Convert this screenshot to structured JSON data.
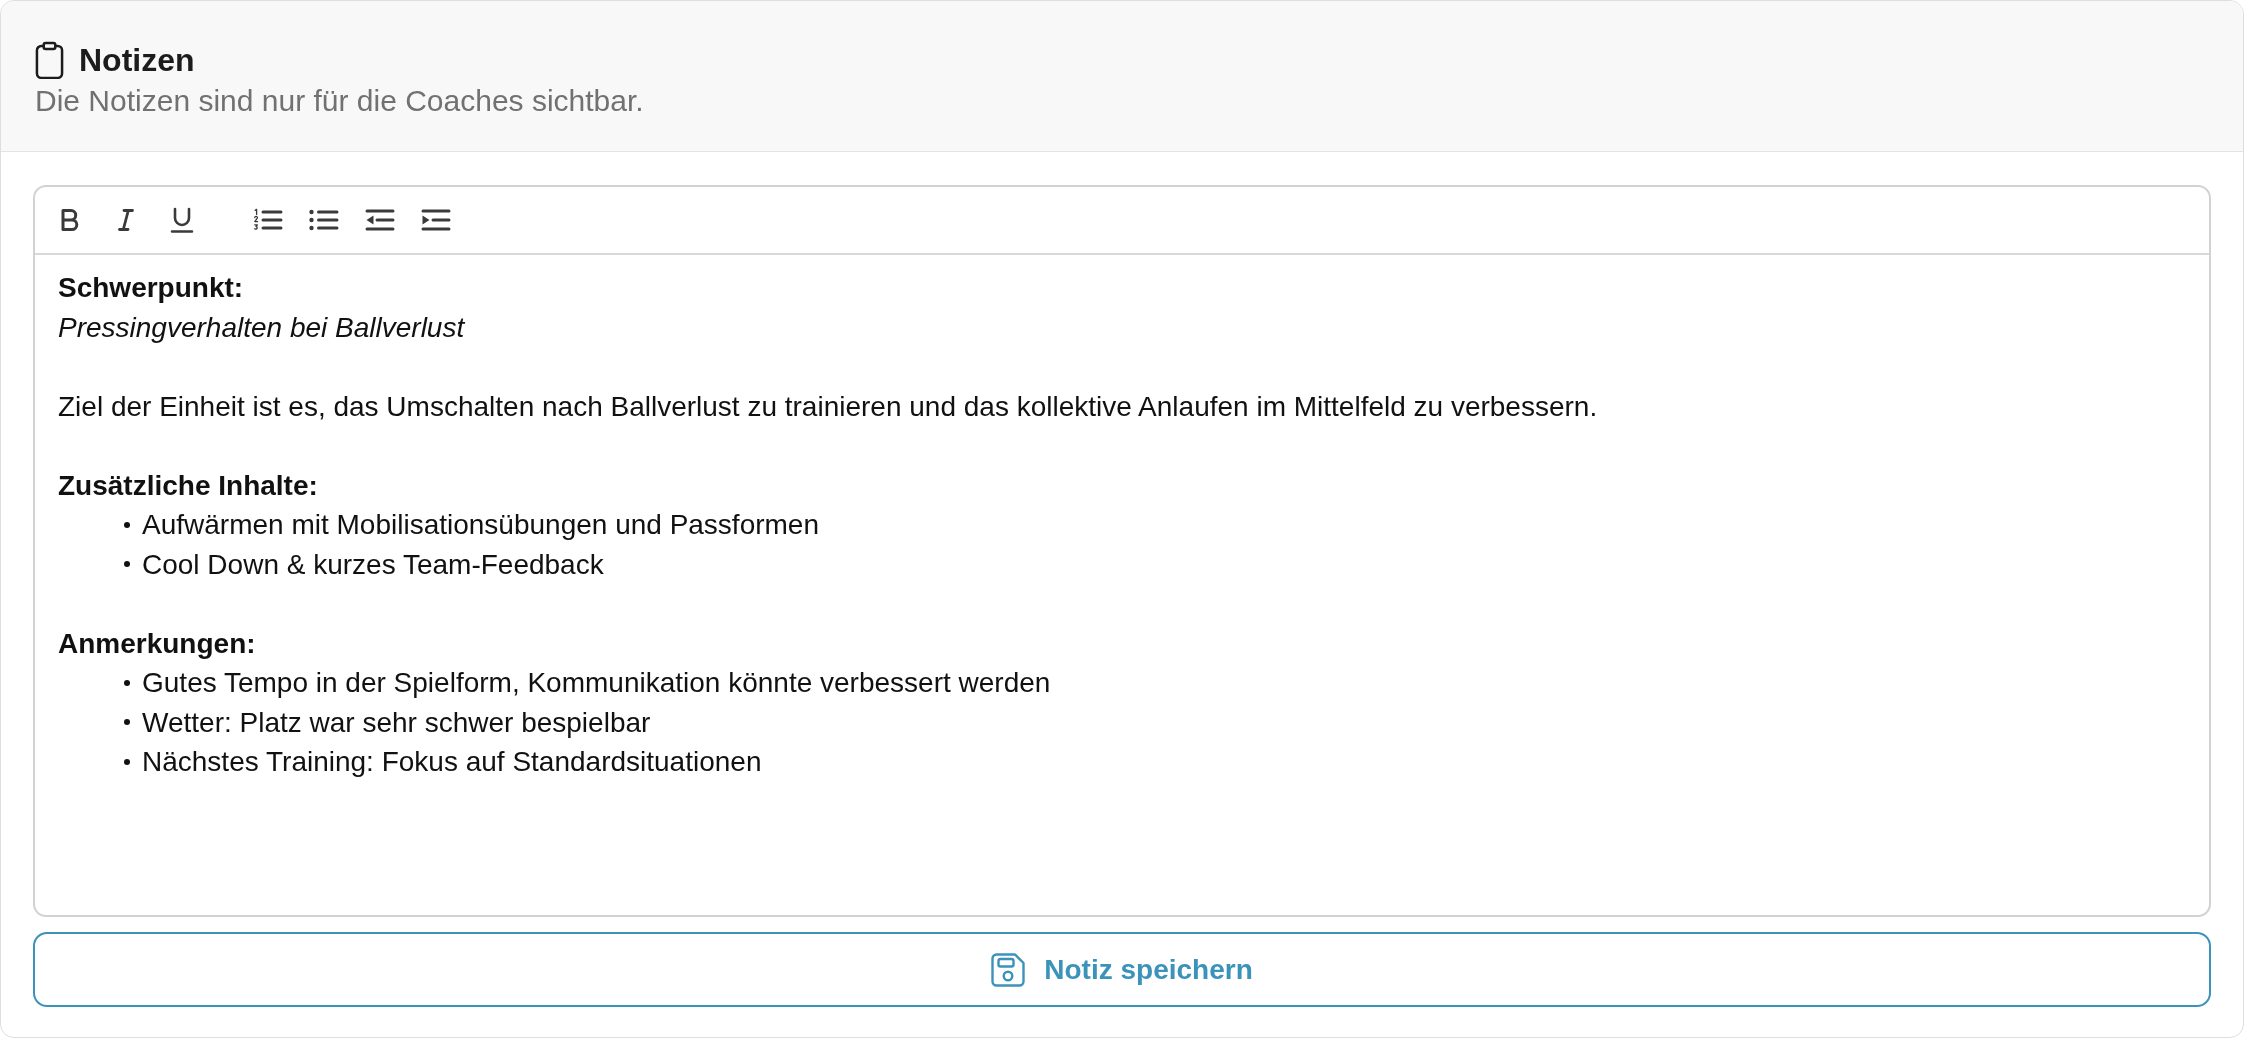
{
  "header": {
    "title": "Notizen",
    "subtitle": "Die Notizen sind nur für die Coaches sichtbar."
  },
  "editor": {
    "focus": {
      "label": "Schwerpunkt:",
      "value": "Pressingverhalten bei Ballverlust"
    },
    "goal": "Ziel der Einheit ist es, das Umschalten nach Ballverlust zu trainieren und das kollektive Anlaufen im Mittelfeld zu verbessern.",
    "sections": [
      {
        "heading": "Zusätzliche Inhalte:",
        "items": [
          "Aufwärmen mit Mobilisationsübungen und Passformen",
          "Cool Down & kurzes Team-Feedback"
        ]
      },
      {
        "heading": "Anmerkungen:",
        "items": [
          "Gutes Tempo in der Spielform, Kommunikation könnte verbessert werden",
          "Wetter: Platz war sehr schwer bespielbar",
          "Nächstes Training: Fokus auf Standardsituationen"
        ]
      }
    ]
  },
  "save_button": {
    "label": "Notiz speichern"
  }
}
